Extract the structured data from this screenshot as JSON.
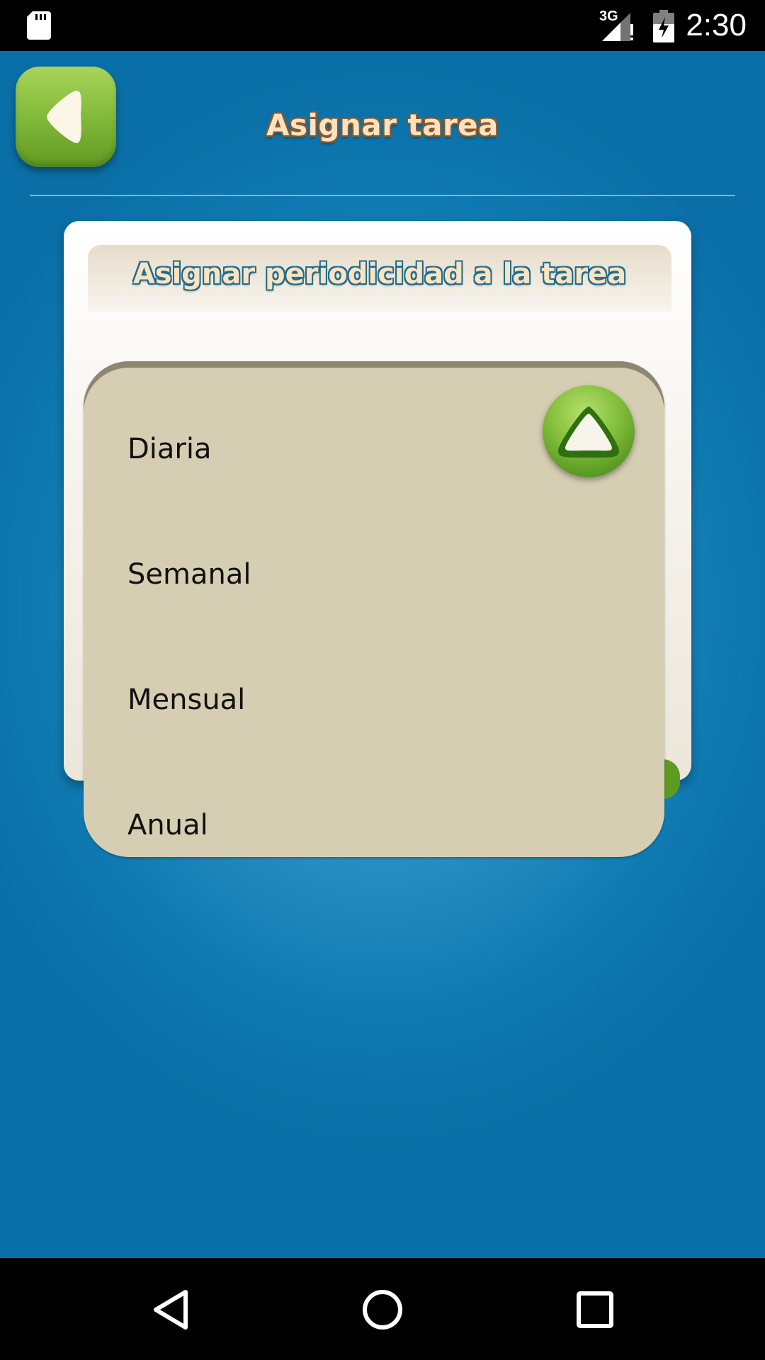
{
  "status_bar": {
    "network": "3G",
    "time": "2:30",
    "icons": [
      "sd-card-icon",
      "signal-icon",
      "battery-charging-icon"
    ]
  },
  "header": {
    "title": "Asignar tarea",
    "back_icon": "back-arrow-icon"
  },
  "card": {
    "title": "Asignar periodicidad a la tarea"
  },
  "dropdown": {
    "selected": "Diaria",
    "options": [
      "Diaria",
      "Semanal",
      "Mensual",
      "Anual"
    ],
    "collapse_icon": "chevron-up-icon"
  },
  "nav_bar": {
    "icons": [
      "back-triangle-icon",
      "home-circle-icon",
      "recents-square-icon"
    ]
  },
  "colors": {
    "background_blue": "#2f93c6",
    "accent_green": "#80bd39",
    "dropdown_bg": "#d6ceb3",
    "title_cream": "#fbe3c2"
  }
}
